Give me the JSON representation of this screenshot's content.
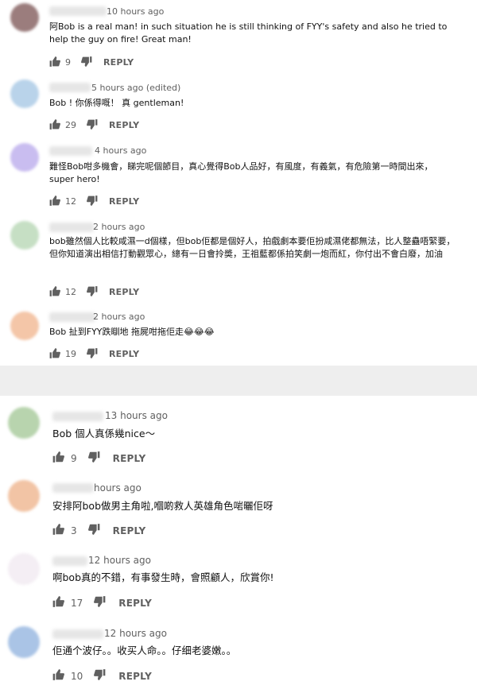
{
  "reply_label": "REPLY",
  "colors": {
    "like_icon": "#606060",
    "divider": "#eeeeee"
  },
  "comments_top": [
    {
      "time": "10 hours ago",
      "text": "阿Bob is a real man! in such situation he is still thinking of FYY's safety and also he tried to help the guy on fire! Great man!",
      "likes": "9",
      "avatar_color": "#9b7d7d"
    },
    {
      "time": "5 hours ago (edited)",
      "text": "Bob ! 你係得嘅！ 真 gentleman!",
      "likes": "29",
      "avatar_color": "#b9d3ea"
    },
    {
      "time": "4 hours ago",
      "text": "難怪Bob咁多機會，睇完呢個節目，真心覺得Bob人品好，有風度，有義氣，有危險第一時間出來，super hero!",
      "likes": "12",
      "avatar_color": "#c9bdf0"
    },
    {
      "time": "2 hours ago",
      "text": "bob雖然個人比較咸濕一d個樣，但bob佢都是個好人，拍戲劇本要佢扮咸濕佬都無法，比人整蠱唔緊要，但你知道演出相信打動觀眾心，總有一日會拎奬，王祖藍都係拍笑劇一炮而紅，你付出不會白廢，加油",
      "likes": "12",
      "avatar_color": "#c6dfc4"
    },
    {
      "time": "2 hours ago",
      "text": "Bob 扯到FYY跌瞓地 拖屍咁拖佢走😂😂😂",
      "likes": "19",
      "avatar_color": "#f4c6a8"
    }
  ],
  "comments_bottom": [
    {
      "time": "13 hours ago",
      "text": "Bob 個人真係幾nice～",
      "likes": "9",
      "avatar_color": "#b8d4ae"
    },
    {
      "time": "hours ago",
      "text": "安排阿bob做男主角啦,嗰啲救人英雄角色啱曬佢呀",
      "likes": "3",
      "avatar_color": "#f2c4a5"
    },
    {
      "time": "12 hours ago",
      "text": "啊bob真的不錯，有事發生時，會照顧人，欣賞你!",
      "likes": "17",
      "avatar_color": "#f4eef4"
    },
    {
      "time": "12 hours ago",
      "text": "佢通个波仔。。收买人命。。仔细老婆嫩。。",
      "likes": "10",
      "avatar_color": "#aac4e6"
    }
  ]
}
